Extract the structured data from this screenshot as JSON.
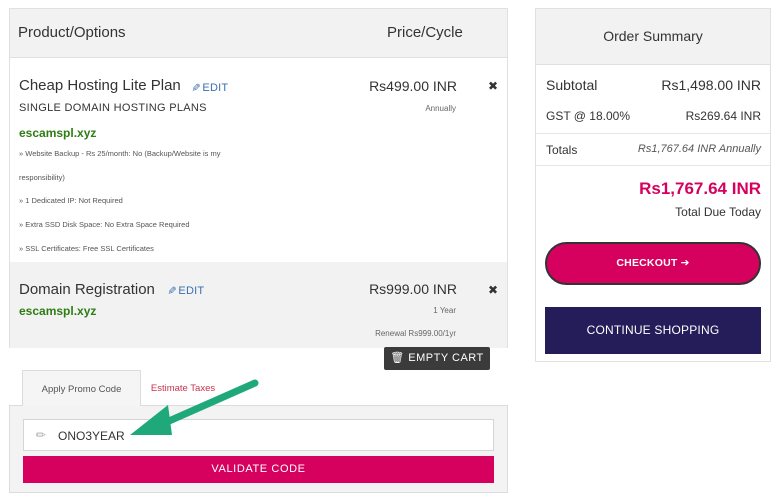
{
  "cart": {
    "header": {
      "product_col": "Product/Options",
      "price_col": "Price/Cycle"
    },
    "items": [
      {
        "name": "Cheap Hosting Lite Plan",
        "edit_label": "EDIT",
        "group": "SINGLE DOMAIN HOSTING PLANS",
        "domain": "escamspl.xyz",
        "options": [
          "» Website Backup - Rs 25/month: No (Backup/Website is my responsibility)",
          "» 1 Dedicated IP: Not Required",
          "» Extra SSD Disk Space: No Extra Space Required",
          "» SSL Certificates: Free SSL Certificates"
        ],
        "price": "Rs499.00 INR",
        "cycle": "Annually",
        "remove_icon": "close-icon"
      },
      {
        "name": "Domain Registration",
        "edit_label": "EDIT",
        "domain": "escamspl.xyz",
        "price": "Rs999.00 INR",
        "cycle": "1 Year",
        "renewal": "Renewal Rs999.00/1yr",
        "remove_icon": "close-icon"
      }
    ],
    "empty_cart_label": "EMPTY CART"
  },
  "promo": {
    "tabs": [
      "Apply Promo Code",
      "Estimate Taxes"
    ],
    "active_tab": "Apply Promo Code",
    "code_value": "ONO3YEAR",
    "validate_label": "VALIDATE CODE"
  },
  "summary": {
    "title": "Order Summary",
    "subtotal_label": "Subtotal",
    "subtotal_value": "Rs1,498.00 INR",
    "gst_label": "GST @ 18.00%",
    "gst_value": "Rs269.64 INR",
    "totals_label": "Totals",
    "totals_value": "Rs1,767.64 INR Annually",
    "total_due": "Rs1,767.64 INR",
    "total_due_label": "Total Due Today",
    "checkout_label": "CHECKOUT",
    "continue_label": "CONTINUE SHOPPING"
  },
  "colors": {
    "accent": "#d6005f",
    "navy": "#241d59",
    "domain_green": "#2e7d13",
    "annotation_arrow": "#1fa97a"
  }
}
